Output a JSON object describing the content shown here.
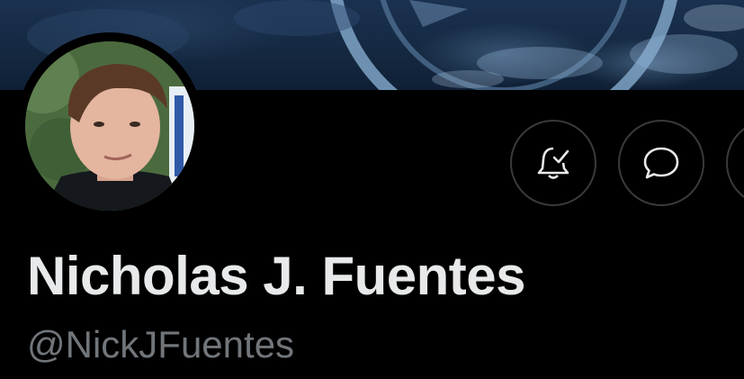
{
  "profile": {
    "display_name": "Nicholas J. Fuentes",
    "handle": "@NickJFuentes"
  },
  "actions": [
    {
      "id": "notify",
      "icon": "bell-check-icon"
    },
    {
      "id": "message",
      "icon": "chat-bubble-icon"
    },
    {
      "id": "more",
      "icon": "more-icon"
    }
  ],
  "colors": {
    "background": "#000000",
    "name_text": "#e7e9ea",
    "handle_text": "#71767b",
    "button_border": "#3a3a3a",
    "banner": "#142840"
  }
}
